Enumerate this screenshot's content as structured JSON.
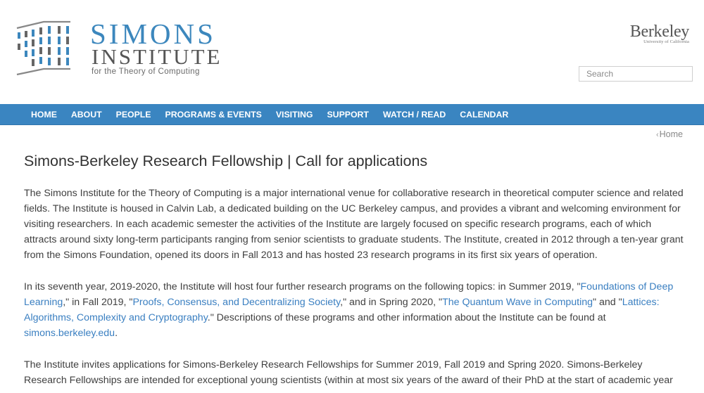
{
  "logo": {
    "line1": "SIMONS",
    "line2": "INSTITUTE",
    "tagline": "for the Theory of Computing"
  },
  "university_logo": {
    "name": "Berkeley",
    "sub": "University of California"
  },
  "search": {
    "placeholder": "Search",
    "value": ""
  },
  "nav": {
    "items": [
      {
        "label": "HOME"
      },
      {
        "label": "ABOUT"
      },
      {
        "label": "PEOPLE"
      },
      {
        "label": "PROGRAMS & EVENTS"
      },
      {
        "label": "VISITING"
      },
      {
        "label": "SUPPORT"
      },
      {
        "label": "WATCH / READ"
      },
      {
        "label": "CALENDAR"
      }
    ]
  },
  "breadcrumb": {
    "chevron": "‹",
    "label": "Home"
  },
  "page": {
    "title": "Simons-Berkeley Research Fellowship | Call for applications",
    "para1": "The Simons Institute for the Theory of Computing is a major international venue for collaborative research in theoretical computer science and related fields. The Institute is housed in Calvin Lab, a dedicated building on the UC Berkeley campus, and provides a vibrant and welcoming environment for visiting researchers. In each academic semester the activities of the Institute are largely focused on specific research programs, each of which attracts around sixty long-term participants ranging from senior scientists to graduate students. The Institute, created in 2012 through a ten-year grant from the Simons Foundation, opened its doors in Fall 2013 and has hosted 23 research programs in its first six years of operation.",
    "para2": {
      "t1": "In its seventh year, 2019-2020, the Institute will host four further research programs on the following topics: in Summer 2019, \"",
      "link1": "Foundations of Deep Learning",
      "t2": ",\" in Fall 2019, \"",
      "link2": "Proofs, Consensus, and Decentralizing Society",
      "t3": ",\" and in Spring 2020, \"",
      "link3": "The Quantum Wave in Computing",
      "t4": "\" and \"",
      "link4": "Lattices: Algorithms, Complexity and Cryptography",
      "t5": ".\" Descriptions of these programs and other information about the Institute can be found at ",
      "link5": "simons.berkeley.edu",
      "t6": "."
    },
    "para3": "The Institute invites applications for Simons-Berkeley Research Fellowships for Summer 2019, Fall 2019 and Spring 2020. Simons-Berkeley Research Fellowships are intended for exceptional young scientists (within at most six years of the award of their PhD at the start of academic year"
  },
  "colors": {
    "brand_blue": "#3c87bd",
    "nav_bg": "#3a85c1",
    "link": "#3a7fc1"
  }
}
